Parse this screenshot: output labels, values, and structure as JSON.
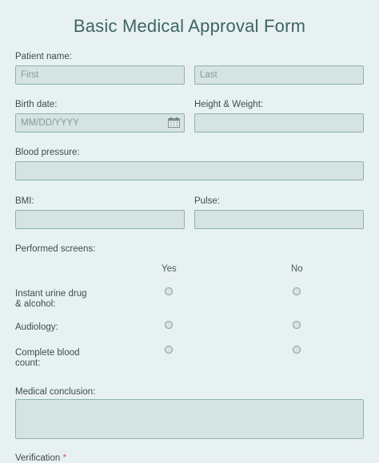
{
  "form": {
    "title": "Basic Medical Approval Form",
    "patient_name": {
      "label": "Patient name:",
      "first_placeholder": "First",
      "last_placeholder": "Last"
    },
    "birth_date": {
      "label": "Birth date:",
      "placeholder": "MM/DD/YYYY",
      "icon": "calendar-icon"
    },
    "height_weight": {
      "label": "Height & Weight:"
    },
    "blood_pressure": {
      "label": "Blood pressure:"
    },
    "bmi": {
      "label": "BMI:"
    },
    "pulse": {
      "label": "Pulse:"
    },
    "screens": {
      "label": "Performed screens:",
      "columns": [
        "Yes",
        "No"
      ],
      "rows": [
        {
          "label": "Instant urine drug\n& alcohol:"
        },
        {
          "label": "Audiology:"
        },
        {
          "label": "Complete blood\ncount:"
        }
      ]
    },
    "medical_conclusion": {
      "label": "Medical conclusion:"
    },
    "next_label_partial": "Verification",
    "required_mark": "*"
  }
}
